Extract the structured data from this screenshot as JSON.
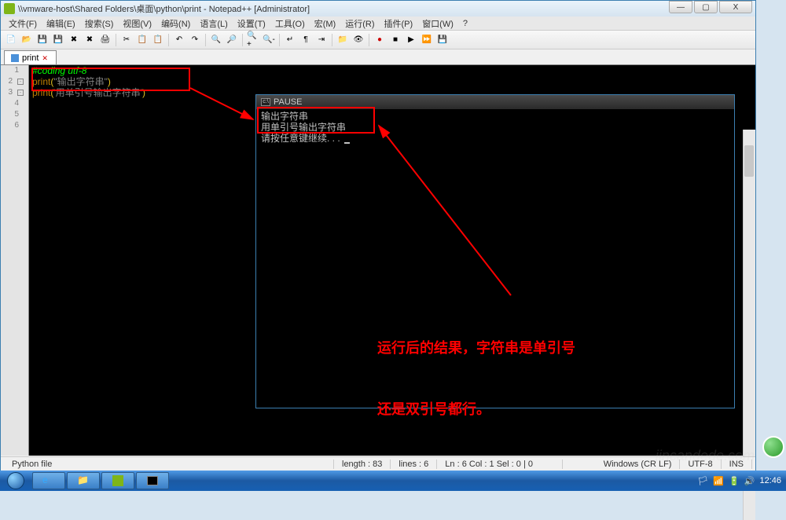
{
  "window": {
    "title": "\\\\vmware-host\\Shared Folders\\桌面\\python\\print - Notepad++ [Administrator]",
    "min": "—",
    "max": "▢",
    "close": "X"
  },
  "menu": {
    "file": "文件(F)",
    "edit": "编辑(E)",
    "search": "搜索(S)",
    "view": "视图(V)",
    "encoding": "编码(N)",
    "language": "语言(L)",
    "settings": "设置(T)",
    "tools": "工具(O)",
    "macro": "宏(M)",
    "run": "运行(R)",
    "plugins": "插件(P)",
    "window": "窗口(W)",
    "help": "?"
  },
  "tab": {
    "name": "print",
    "close": "✕"
  },
  "gutter": {
    "l1": "1",
    "l2": "2",
    "l3": "3",
    "l4": "4",
    "l5": "5",
    "l6": "6"
  },
  "code": {
    "l1_comment": "#coding utf-8",
    "l2_func": "print",
    "l2_open": "(",
    "l2_str": "\"输出字符串\"",
    "l2_close": ")",
    "l3_func": "print",
    "l3_open": "(",
    "l3_str": "'用单引号输出字符串'",
    "l3_close": ")"
  },
  "console": {
    "title": "PAUSE",
    "line1": "输出字符串",
    "line2": "用单引号输出字符串",
    "line3": "",
    "line4": "请按任意键继续. . . "
  },
  "annotation": {
    "line1": "运行后的结果，字符串是单引号",
    "line2": "还是双引号都行。"
  },
  "status": {
    "filetype": "Python file",
    "length": "length : 83",
    "lines": "lines : 6",
    "pos": "Ln : 6    Col : 1    Sel : 0 | 0",
    "eol": "Windows (CR LF)",
    "enc": "UTF-8",
    "ins": "INS"
  },
  "tray": {
    "time": "12:46"
  },
  "colors": {
    "red": "#ff0000",
    "comment": "#00ff00",
    "func": "#c08000"
  },
  "watermark": "jincandede.com"
}
